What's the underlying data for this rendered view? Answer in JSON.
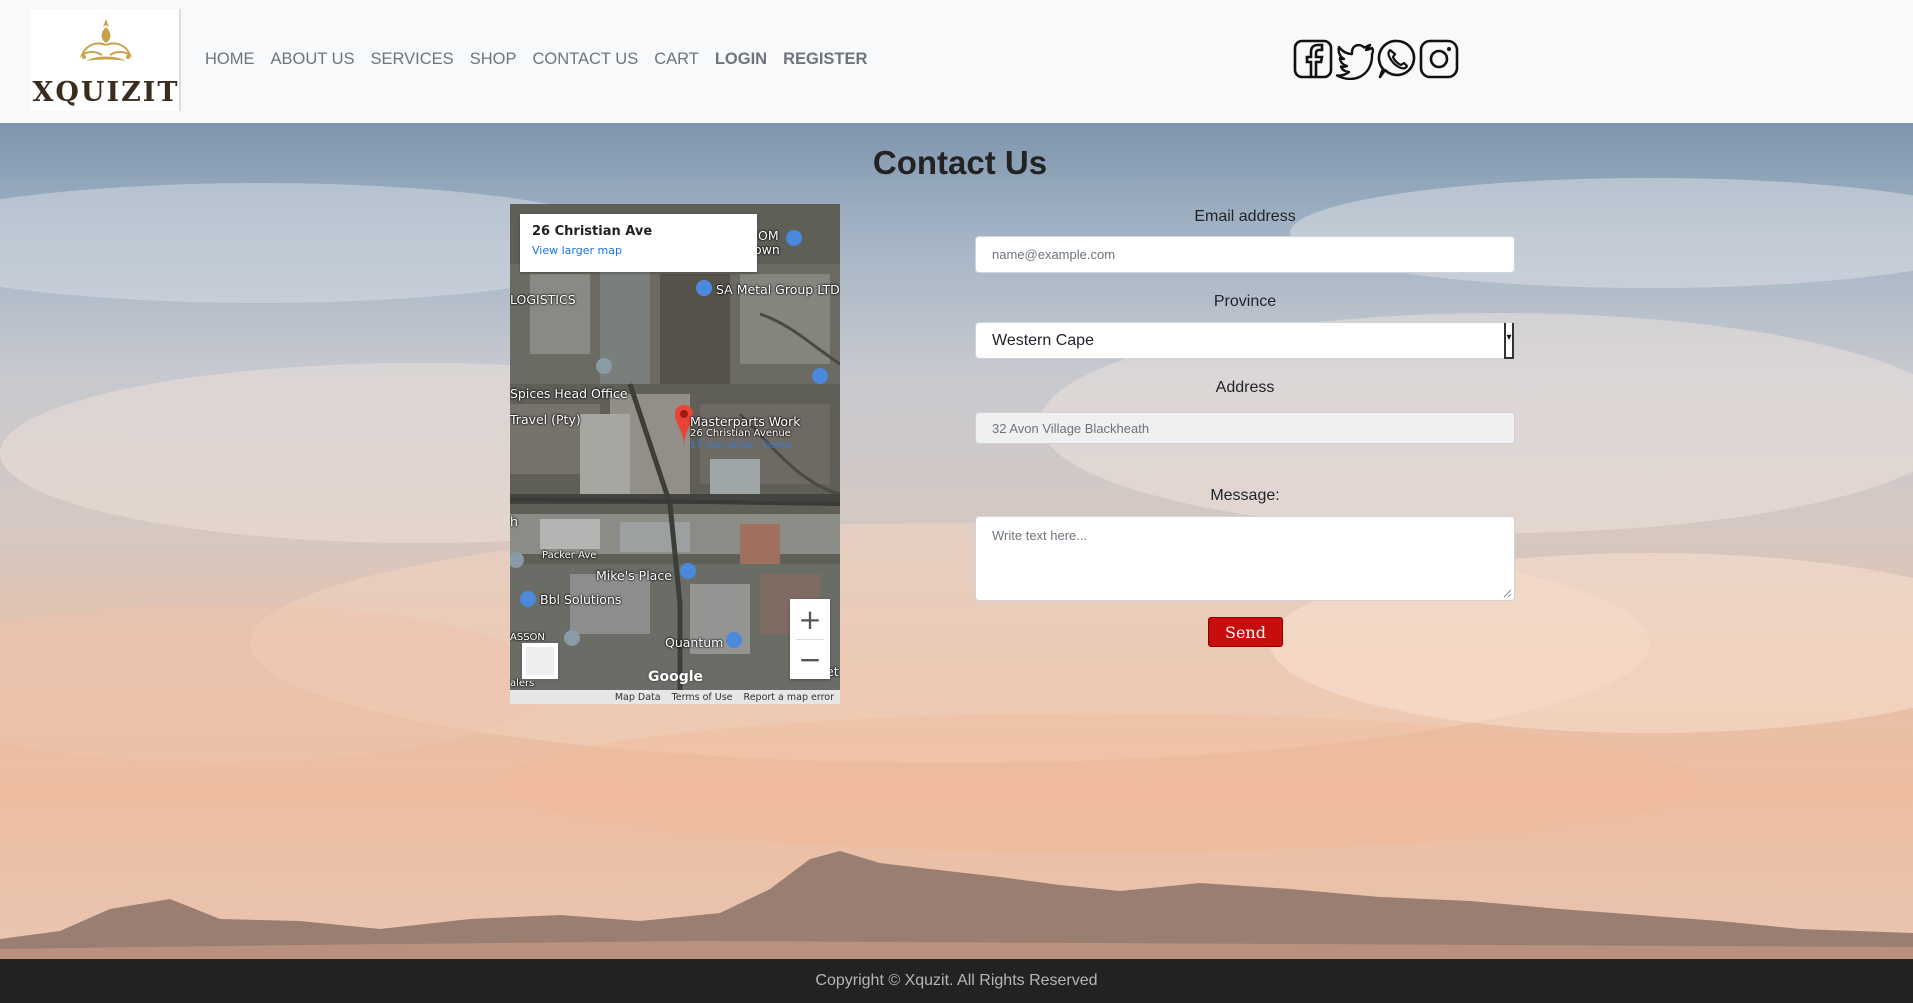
{
  "brand": {
    "name": "XQUIZIT",
    "accent": "#c8a24a"
  },
  "nav": {
    "items": [
      "HOME",
      "ABOUT US",
      "SERVICES",
      "SHOP",
      "CONTACT US",
      "CART"
    ],
    "login": "LOGIN",
    "register": "REGISTER"
  },
  "social": [
    "facebook-icon",
    "twitter-icon",
    "whatsapp-icon",
    "instagram-icon"
  ],
  "page": {
    "title": "Contact Us"
  },
  "map": {
    "place": "26 Christian Ave",
    "link": "View larger map",
    "labels": [
      "OM",
      "own",
      "SA Metal Group LTD",
      "LOGISTICS",
      "Spices Head Office",
      "Travel (Pty)",
      "Masterparts Work",
      "26 Christian Avenue",
      "17 min drive - home",
      "Packer Ave",
      "Mike's Place",
      "Bbl Solutions",
      "Quantum",
      "ASSON",
      "alers",
      "h",
      "et"
    ],
    "zoom_in": "+",
    "zoom_out": "−",
    "logo": "Google",
    "footer": [
      "Map Data",
      "Terms of Use",
      "Report a map error"
    ]
  },
  "form": {
    "email_label": "Email address",
    "email_placeholder": "name@example.com",
    "province_label": "Province",
    "province_value": "Western Cape",
    "address_label": "Address",
    "address_value": "32 Avon Village Blackheath",
    "message_label": "Message:",
    "message_placeholder": "Write text here...",
    "send_label": "Send",
    "send_color": "#c80d0d"
  },
  "footer": {
    "copyright": "Copyright © Xquzit. All Rights Reserved"
  }
}
